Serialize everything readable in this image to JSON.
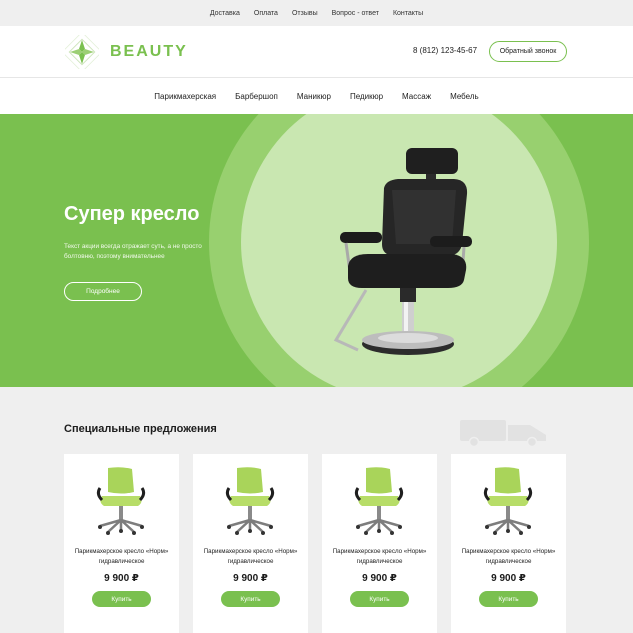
{
  "topbar": {
    "links": [
      "Доставка",
      "Оплата",
      "Отзывы",
      "Вопрос - ответ",
      "Контакты"
    ]
  },
  "header": {
    "brand": "BEAUTY",
    "phone": "8 (812) 123-45-67",
    "callback_label": "Обратный звонок"
  },
  "nav": {
    "items": [
      "Парикмахерская",
      "Барбершоп",
      "Маникюр",
      "Педикюр",
      "Массаж",
      "Мебель"
    ]
  },
  "hero": {
    "title": "Супер кресло",
    "text": "Текст акции всегда отражает суть, а не просто болтовню, поэтому внимательнее",
    "button_label": "Подробнее"
  },
  "offers": {
    "title": "Специальные предложения",
    "products": [
      {
        "name": "Парикмахерское кресло «Норм» гидравлическое",
        "price": "9 900 ₽",
        "buy_label": "Купить"
      },
      {
        "name": "Парикмахерское кресло «Норм» гидравлическое",
        "price": "9 900 ₽",
        "buy_label": "Купить"
      },
      {
        "name": "Парикмахерское кресло «Норм» гидравлическое",
        "price": "9 900 ₽",
        "buy_label": "Купить"
      },
      {
        "name": "Парикмахерское кресло «Норм» гидравлическое",
        "price": "9 900 ₽",
        "buy_label": "Купить"
      }
    ]
  },
  "colors": {
    "accent": "#7ac04f",
    "hero_ring_outer": "#98d06f",
    "hero_ring_inner": "#c9e7b1",
    "page_gray": "#efefef"
  },
  "icons": [
    "logo-icon",
    "truck-icon",
    "barber-chair-image",
    "office-chair-image"
  ]
}
